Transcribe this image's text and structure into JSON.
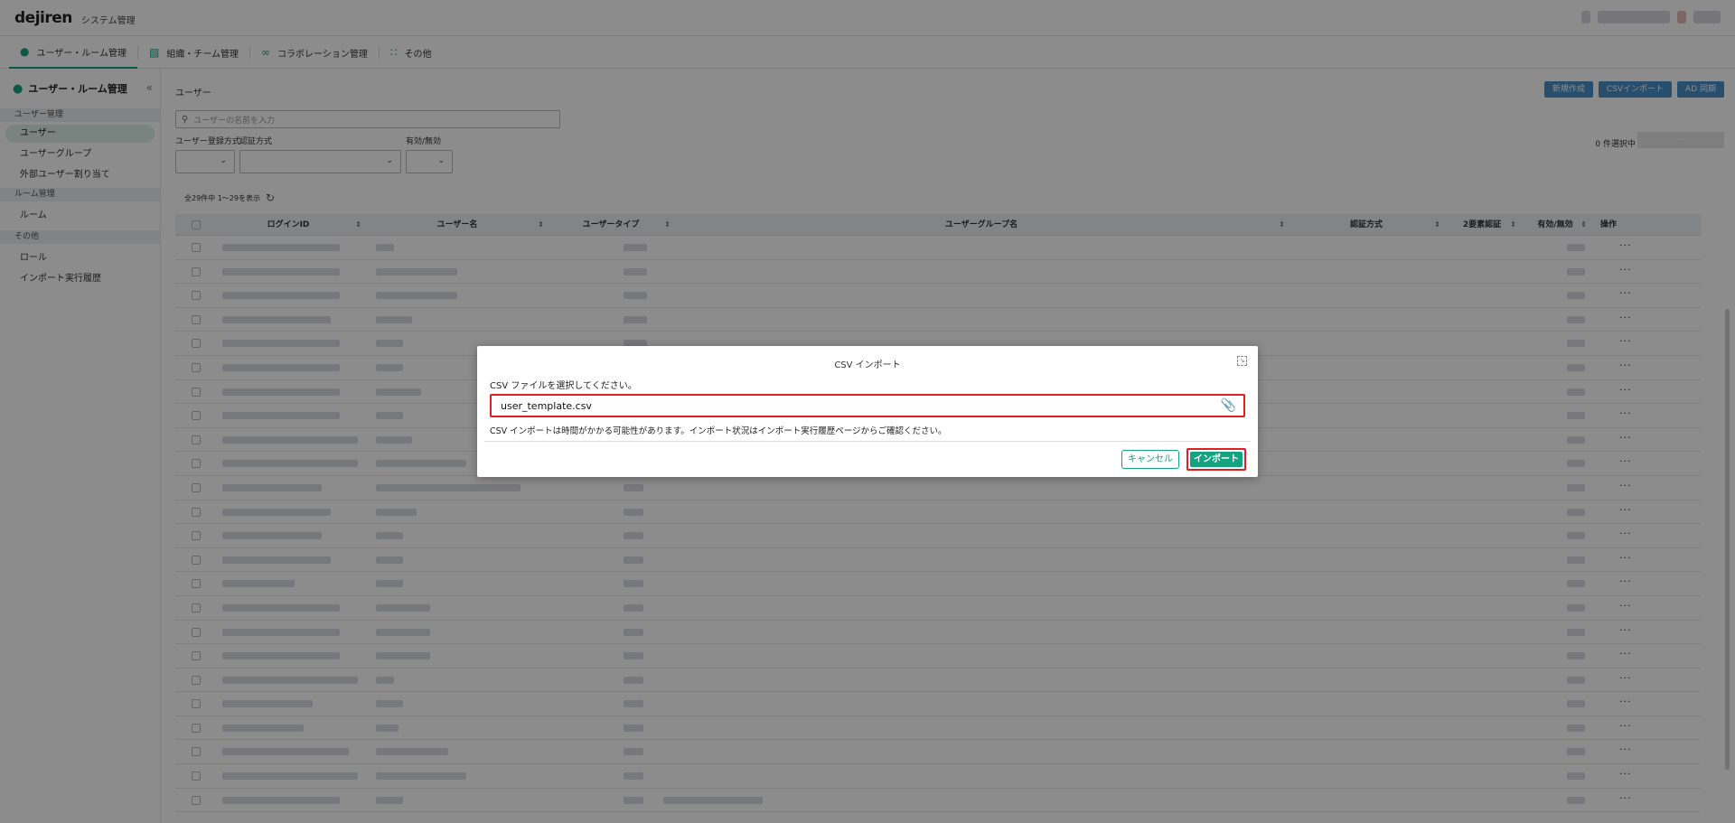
{
  "header": {
    "logo": "dejiren",
    "title": "システム管理"
  },
  "nav": {
    "tabs": [
      {
        "label": "ユーザー・ルーム管理"
      },
      {
        "label": "組織・チーム管理"
      },
      {
        "label": "コラボレーション管理"
      },
      {
        "label": "その他"
      }
    ]
  },
  "sidebar": {
    "title": "ユーザー・ルーム管理",
    "groups": [
      {
        "label": "ユーザー管理",
        "items": [
          "ユーザー",
          "ユーザーグループ",
          "外部ユーザー割り当て"
        ]
      },
      {
        "label": "ルーム管理",
        "items": [
          "ルーム"
        ]
      },
      {
        "label": "その他",
        "items": [
          "ロール",
          "インポート実行履歴"
        ]
      }
    ]
  },
  "main": {
    "title": "ユーザー",
    "actions": [
      "新規作成",
      "CSVインポート",
      "AD 同期"
    ],
    "search_placeholder": "ユーザーの名前を入力",
    "filters": [
      "ユーザー登録方式",
      "認証方式",
      "有効/無効"
    ],
    "selected_count": "0 件選択中",
    "range_text": "全29件中 1〜29を表示",
    "columns": [
      "ログインID",
      "ユーザー名",
      "ユーザータイプ",
      "ユーザーグループ名",
      "認証方式",
      "2要素認証",
      "有効/無効",
      "操作"
    ]
  },
  "modal": {
    "title": "CSV インポート",
    "label": "CSV ファイルを選択してください。",
    "file_name": "user_template.csv",
    "note": "CSV インポートは時間がかかる可能性があります。インポート状況はインポート実行履歴ページからご確認ください。",
    "cancel_label": "キャンセル",
    "import_label": "インポート"
  },
  "colors": {
    "accent": "#15a37f",
    "primary_blue": "#4a8ec6",
    "highlight": "#e02020"
  }
}
